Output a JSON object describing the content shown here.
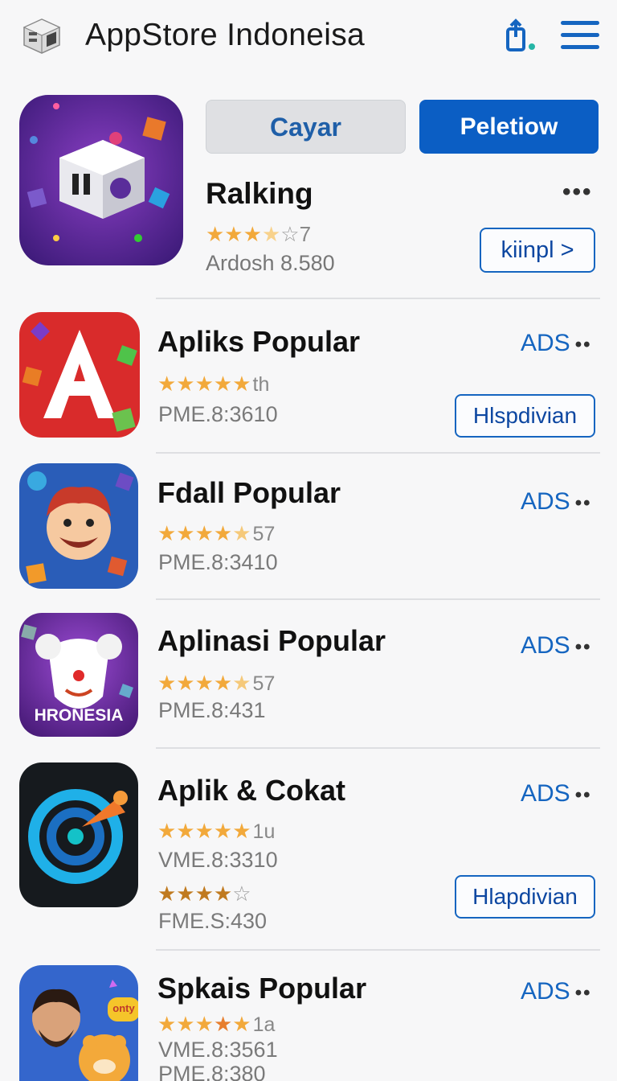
{
  "header": {
    "title": "AppStore  Indoneisa",
    "icons": [
      "app-logo-icon",
      "share-icon",
      "hamburger-menu-icon"
    ],
    "accent_color": "#1565c0"
  },
  "featured": {
    "secondary_button": "Cayar",
    "primary_button": "Peletiow",
    "name": "Ralking",
    "more": "•••",
    "rating_text": "7",
    "rating": 3.5,
    "subtitle": "Ardosh 8.580",
    "action_button": "kiinpl >"
  },
  "apps": [
    {
      "name": "Apliks Popular",
      "ads": "ADS",
      "dots": "••",
      "rating_text": "th",
      "meta": "PME.8:3610",
      "action_button": "Hlspdivian",
      "icon": "red-a-icon"
    },
    {
      "name": "Fdall Popular",
      "ads": "ADS",
      "dots": "••",
      "rating_text": "57",
      "meta": "PME.8:3410",
      "icon": "cartoon-face-icon"
    },
    {
      "name": "Aplinasi Popular",
      "ads": "ADS",
      "dots": "••",
      "rating_text": "57",
      "meta": "PME.8:431",
      "icon_caption": "HRONESIA",
      "icon": "clown-icon"
    },
    {
      "name": "Aplik & Cokat",
      "ads": "ADS",
      "dots": "••",
      "rating_text": "1u",
      "meta": "VME.8:3310",
      "rating_text_2": "",
      "meta_2": "FME.S:430",
      "action_button": "Hlapdivian",
      "icon": "target-rocket-icon"
    },
    {
      "name": "Spkais Popular",
      "ads": "ADS",
      "dots": "••",
      "rating_text": "1a",
      "meta": "VME.8:3561",
      "meta_2": "PME.8:380",
      "icon_caption": "onty",
      "icon": "man-and-bear-icon"
    }
  ],
  "star_glyph": "★",
  "star_empty_glyph": "☆"
}
